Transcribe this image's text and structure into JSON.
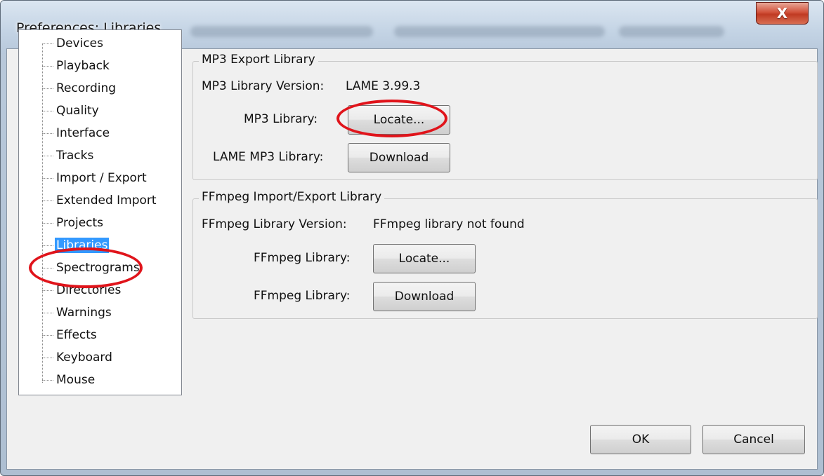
{
  "window": {
    "title": "Preferences: Libraries",
    "close_glyph": "X"
  },
  "sidebar": {
    "items": [
      {
        "label": "Devices"
      },
      {
        "label": "Playback"
      },
      {
        "label": "Recording"
      },
      {
        "label": "Quality"
      },
      {
        "label": "Interface"
      },
      {
        "label": "Tracks"
      },
      {
        "label": "Import / Export"
      },
      {
        "label": "Extended Import"
      },
      {
        "label": "Projects"
      },
      {
        "label": "Libraries",
        "selected": true
      },
      {
        "label": "Spectrograms"
      },
      {
        "label": "Directories"
      },
      {
        "label": "Warnings"
      },
      {
        "label": "Effects"
      },
      {
        "label": "Keyboard"
      },
      {
        "label": "Mouse"
      }
    ]
  },
  "mp3": {
    "group_title": "MP3 Export Library",
    "version_label": "MP3 Library Version:",
    "version_value": "LAME 3.99.3",
    "library_label": "MP3 Library:",
    "locate_button": "Locate...",
    "lame_label": "LAME MP3 Library:",
    "download_button": "Download"
  },
  "ffmpeg": {
    "group_title": "FFmpeg Import/Export Library",
    "version_label": "FFmpeg Library Version:",
    "version_value": "FFmpeg library not found",
    "library_label": "FFmpeg Library:",
    "locate_button": "Locate...",
    "download_label": "FFmpeg Library:",
    "download_button": "Download"
  },
  "footer": {
    "ok_button": "OK",
    "cancel_button": "Cancel"
  },
  "colors": {
    "selection": "#3399ff",
    "annotation": "#e0141b",
    "close_button": "#c03a23"
  }
}
